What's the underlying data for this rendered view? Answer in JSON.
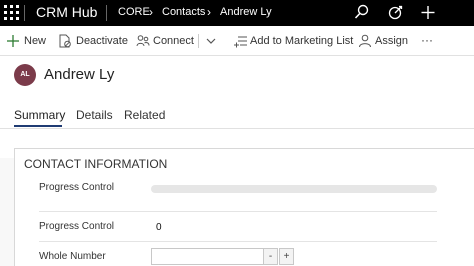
{
  "app": {
    "title": "CRM Hub"
  },
  "breadcrumb": {
    "items": [
      "CORE",
      "Contacts",
      "Andrew Ly"
    ]
  },
  "topbar_icons": [
    "search-icon",
    "target-icon",
    "plus-icon"
  ],
  "commands": {
    "new": "New",
    "deactivate": "Deactivate",
    "connect": "Connect",
    "add_to_marketing_list": "Add to Marketing List",
    "assign": "Assign",
    "more": "···"
  },
  "record": {
    "initials": "AL",
    "name": "Andrew Ly",
    "avatar_color": "#7b3b4a"
  },
  "tabs": [
    "Summary",
    "Details",
    "Related"
  ],
  "active_tab": "Summary",
  "section": {
    "title": "CONTACT INFORMATION",
    "fields": {
      "progress_1_label": "Progress Control",
      "progress_1_value": 0,
      "progress_2_label": "Progress Control",
      "progress_2_value": "0",
      "whole_number_label": "Whole Number",
      "whole_number_value": "",
      "decrement": "-",
      "increment": "+"
    }
  },
  "colors": {
    "topbar": "#000000",
    "accent": "#1f3b73"
  }
}
